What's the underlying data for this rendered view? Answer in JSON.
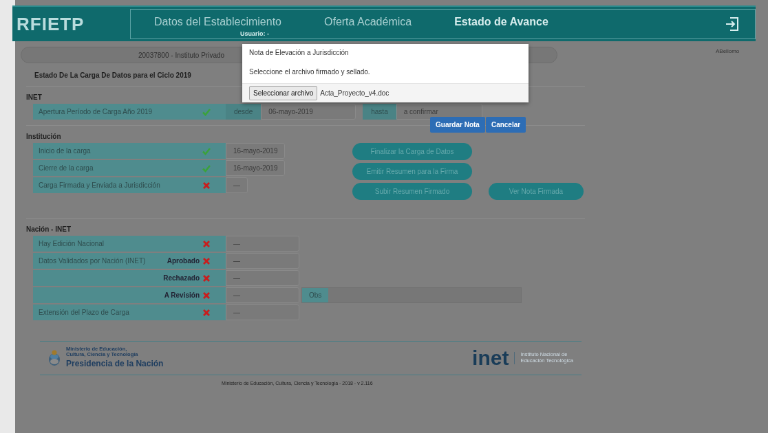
{
  "header": {
    "brand": "RFIETP",
    "nav": [
      {
        "label": "Datos del Establecimiento",
        "selected": false
      },
      {
        "label": "Oferta Académica",
        "selected": false
      },
      {
        "label": "Estado de Avance",
        "selected": true
      }
    ],
    "user_label": "Usuario:",
    "user_value": "-"
  },
  "school_bar": {
    "school": "20037800 - Instituto Privado",
    "user_name": "ABellomo"
  },
  "page_title": "Estado De La Carga De Datos para el Ciclo 2019",
  "sections": [
    {
      "title": "INET",
      "rows": [
        {
          "kind": "range",
          "label": "Apertura Período de Carga Año 2019",
          "ok": true,
          "from_label": "desde",
          "from": "06-mayo-2019",
          "to_label": "hasta",
          "to": "a confirmar"
        }
      ]
    },
    {
      "title": "Institución",
      "rows": [
        {
          "kind": "status",
          "label": "Inicio de la carga",
          "ok": true,
          "value": "16-mayo-2019"
        },
        {
          "kind": "status",
          "label": "Cierre de la carga",
          "ok": true,
          "value": "16-mayo-2019"
        },
        {
          "kind": "status",
          "label": "Carga Firmada y Enviada a Jurisdicción",
          "ok": false,
          "value": "—"
        }
      ],
      "actions": [
        [
          "Finalizar la Carga de Datos"
        ],
        [
          "Emitir Resumen para la Firma"
        ],
        [
          "Subir Resumen Firmado",
          "Ver Nota Firmada"
        ]
      ]
    },
    {
      "title": "Nación - INET",
      "rows": [
        {
          "kind": "status",
          "label": "Hay Edición Nacional",
          "ok": false,
          "value": "—"
        },
        {
          "kind": "status",
          "label": "Datos Validados por Nación (INET)",
          "sub_label": "Aprobado",
          "ok": false,
          "value": "—"
        },
        {
          "kind": "status",
          "sub_label": "Rechazado",
          "ok": false,
          "value": "—"
        },
        {
          "kind": "status",
          "sub_label": "A Revisión",
          "ok": false,
          "value": "—",
          "obs_label": "Obs"
        },
        {
          "kind": "status",
          "label": "Extensión del Plazo de Carga",
          "ok": false,
          "value": "—"
        }
      ]
    }
  ],
  "footer": {
    "ministry_lines": [
      "Ministerio de Educación,",
      "Cultura, Ciencia y Tecnología"
    ],
    "presidency": "Presidencia de la Nación",
    "inet": "inet",
    "inet_lines": [
      "Instituto Nacional de",
      "Educación Tecnológica"
    ],
    "credits": "Ministerio de Educación, Cultura, Ciencia y Tecnología - 2018 - v 2.116"
  },
  "modal": {
    "title": "Nota de Elevación a Jurisdicción",
    "text": "Seleccione el archivo firmado y sellado.",
    "file_button": "Seleccionar archivo",
    "file_name": "Acta_Proyecto_v4.doc",
    "buttons": [
      {
        "label": "Guardar Nota",
        "kind": "primary"
      },
      {
        "label": "Cancelar",
        "kind": "primary"
      }
    ]
  }
}
